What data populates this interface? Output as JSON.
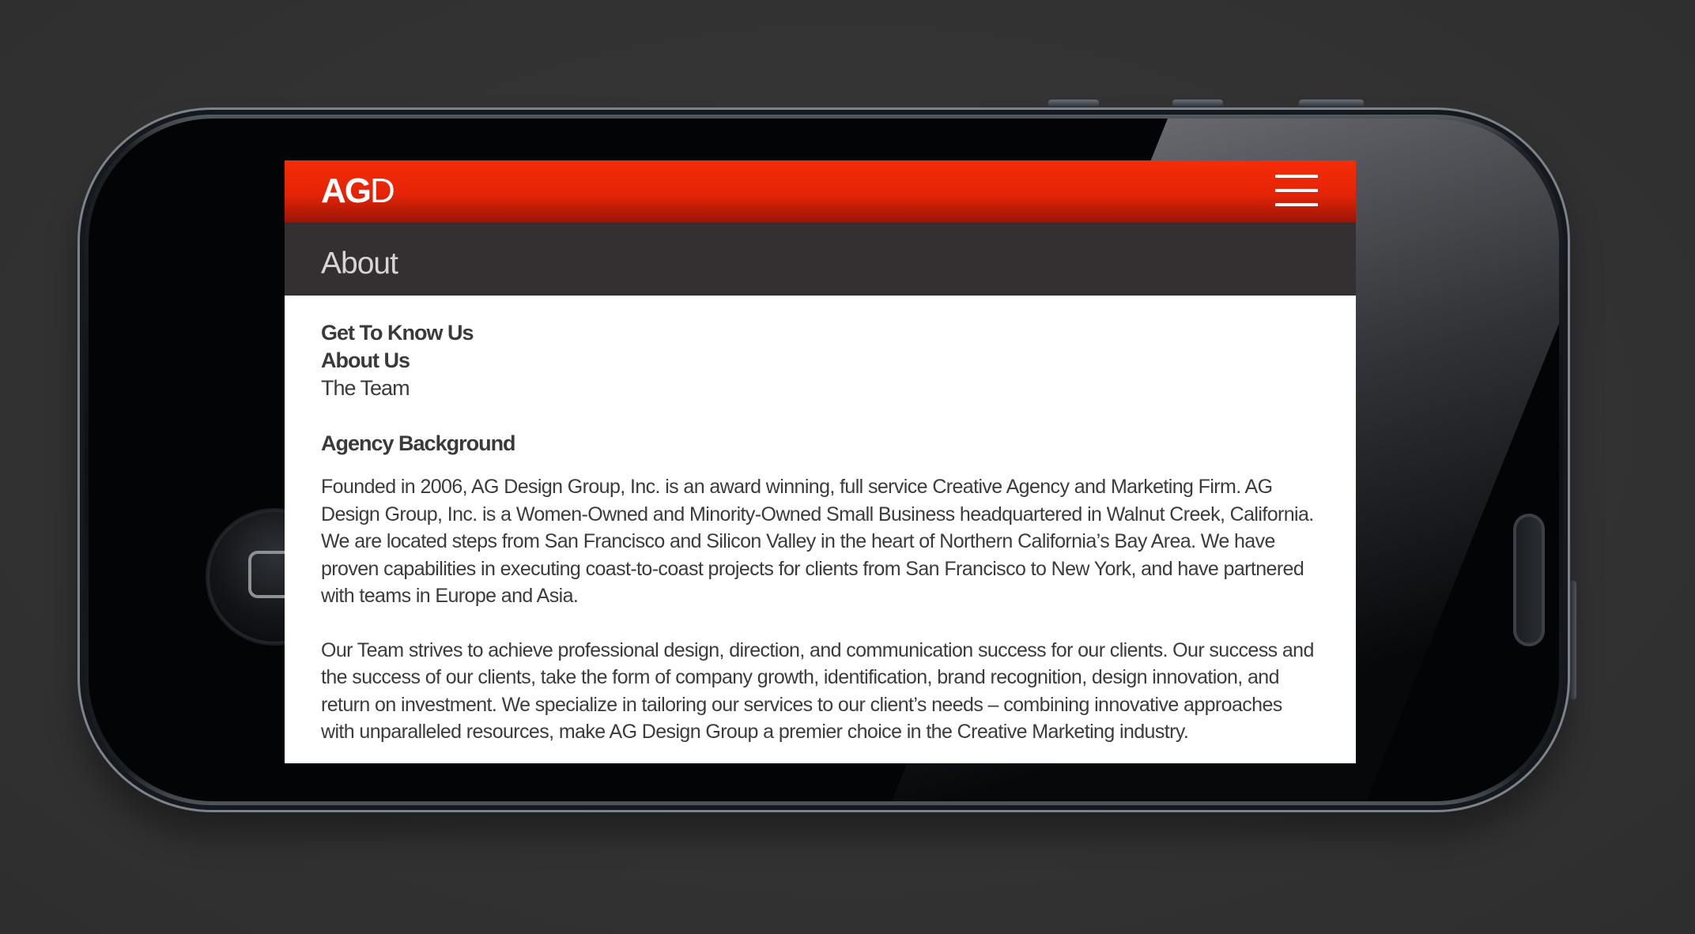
{
  "header": {
    "logo_bold": "AG",
    "logo_thin": "D"
  },
  "page": {
    "title": "About"
  },
  "subnav": {
    "heading": "Get To Know Us",
    "items": [
      {
        "label": "About Us",
        "active": true
      },
      {
        "label": "The Team",
        "active": false
      }
    ]
  },
  "section": {
    "title": "Agency Background",
    "paragraphs": [
      "Founded in 2006, AG Design Group, Inc. is an award winning, full service Creative Agency and Marketing Firm. AG Design Group, Inc. is a Women-Owned and Minority-Owned Small Business headquartered in Walnut Creek, California. We are located steps from San Francisco and Silicon Valley in the heart of Northern California’s Bay Area. We have proven capabilities in executing coast-to-coast projects for clients from San Francisco to New York, and have partnered with teams in Europe and Asia.",
      "Our Team strives to achieve professional design, direction, and communication success for our clients. Our success and the success of our clients, take the form of company growth, identification, brand recognition, design innovation, and return on investment. We specialize in tailoring our services to our client’s needs – combining innovative approaches with unparalleled resources, make AG Design Group a premier choice in the Creative Marketing industry."
    ]
  },
  "colors": {
    "brand_red": "#e52406",
    "subheader_bg": "#342f30",
    "text": "#3a3a3a"
  },
  "icons": {
    "menu": "hamburger-menu-icon",
    "home": "home-button-icon"
  }
}
